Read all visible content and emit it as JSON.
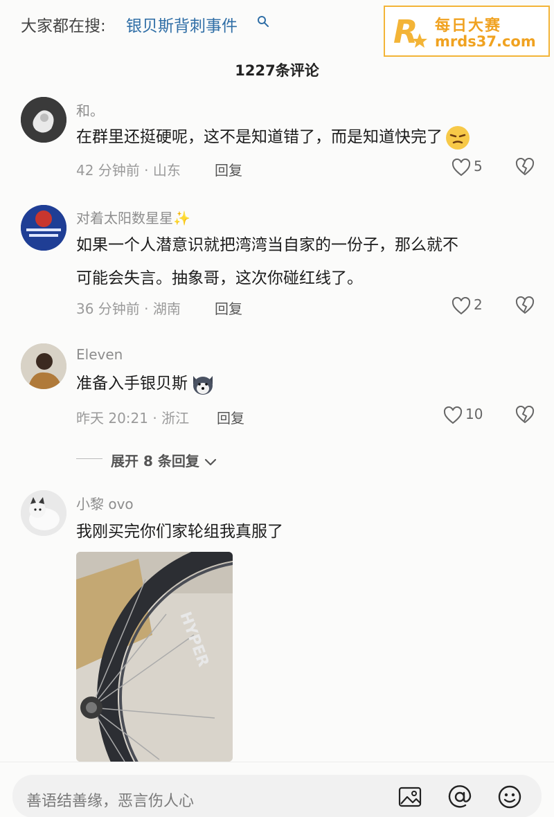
{
  "header": {
    "search_prefix": "大家都在搜:",
    "search_term": "银贝斯背刺事件",
    "close_label": "×"
  },
  "watermark": {
    "line1": "每日大赛",
    "line2": "mrds37.com",
    "logo_letter": "R"
  },
  "comments_title": "1227条评论",
  "comments": [
    {
      "username": "和。",
      "text": "在群里还挺硬呢，这不是知道错了，而是知道快完了",
      "emoji": "smirk-emoji",
      "time_location": "42 分钟前 · 山东",
      "reply_label": "回复",
      "likes": "5"
    },
    {
      "username": "对着太阳数星星✨",
      "text_line1": "如果一个人潜意识就把湾湾当自家的一份子，那么就不",
      "text_line2": "可能会失言。抽象哥，这次你碰红线了。",
      "time_location": "36 分钟前 · 湖南",
      "reply_label": "回复",
      "likes": "2"
    },
    {
      "username": "Eleven",
      "text": "准备入手银贝斯",
      "emoji": "husky-emoji",
      "time_location": "昨天 20:21 · 浙江",
      "reply_label": "回复",
      "likes": "10"
    },
    {
      "username": "小黎 ovo",
      "text": "我刚买完你们家轮组我真服了",
      "photo_text": "HYPER"
    }
  ],
  "expand_replies": "展开 8 条回复",
  "input": {
    "placeholder": "善语结善缘，恶言伤人心"
  },
  "colors": {
    "link_blue": "#2f6ea6",
    "watermark_orange": "#f0a220"
  }
}
